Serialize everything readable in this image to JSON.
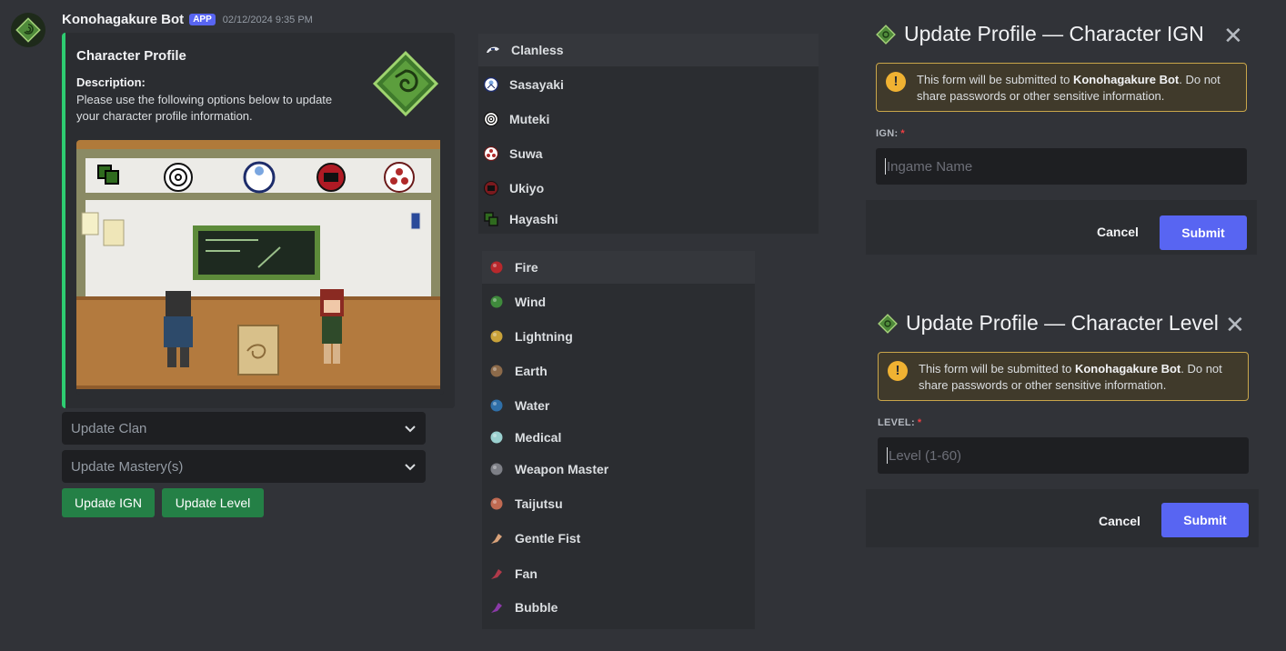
{
  "message": {
    "username": "Konohagakure Bot",
    "badge": "APP",
    "timestamp": "02/12/2024 9:35 PM",
    "embed": {
      "title": "Character Profile",
      "description_label": "Description:",
      "description": "Please use the following options below to update your character profile information.",
      "accent_color": "#2ecc71"
    },
    "components": {
      "clan_select_placeholder": "Update Clan",
      "mastery_select_placeholder": "Update Mastery(s)",
      "update_ign_label": "Update IGN",
      "update_level_label": "Update Level"
    }
  },
  "clan_options": [
    {
      "label": "Clanless",
      "icon": "clanless-icon",
      "highlighted": true
    },
    {
      "label": "Sasayaki",
      "icon": "sasayaki-clan-icon"
    },
    {
      "label": "Muteki",
      "icon": "muteki-clan-icon"
    },
    {
      "label": "Suwa",
      "icon": "suwa-clan-icon"
    },
    {
      "label": "Ukiyo",
      "icon": "ukiyo-clan-icon"
    },
    {
      "label": "Hayashi",
      "icon": "hayashi-clan-icon"
    }
  ],
  "mastery_options": [
    {
      "label": "Fire",
      "icon": "fire-orb-icon",
      "color": "#b8282c",
      "highlighted": true
    },
    {
      "label": "Wind",
      "icon": "wind-orb-icon",
      "color": "#3f8a3c"
    },
    {
      "label": "Lightning",
      "icon": "lightning-orb-icon",
      "color": "#c9a23a"
    },
    {
      "label": "Earth",
      "icon": "earth-orb-icon",
      "color": "#8c6a4a"
    },
    {
      "label": "Water",
      "icon": "water-orb-icon",
      "color": "#2f6fa8"
    },
    {
      "label": "Medical",
      "icon": "medical-orb-icon",
      "color": "#9ad0cf"
    },
    {
      "label": "Weapon Master",
      "icon": "weapon-orb-icon",
      "color": "#7d7f86"
    },
    {
      "label": "Taijutsu",
      "icon": "taijutsu-orb-icon",
      "color": "#c06a52"
    },
    {
      "label": "Gentle Fist",
      "icon": "gentle-fist-icon",
      "color": "#d9a27a"
    },
    {
      "label": "Fan",
      "icon": "fan-icon",
      "color": "#b13a4a"
    },
    {
      "label": "Bubble",
      "icon": "bubble-wand-icon",
      "color": "#8b3aa8"
    }
  ],
  "modal_ign": {
    "title": "Update Profile — Character IGN",
    "warning_prefix": "This form will be submitted to ",
    "warning_bold": "Konohagakure Bot",
    "warning_suffix": ". Do not share passwords or other sensitive information.",
    "field_label": "IGN:",
    "required_mark": "*",
    "placeholder": "Ingame Name",
    "cancel": "Cancel",
    "submit": "Submit"
  },
  "modal_level": {
    "title": "Update Profile — Character Level",
    "warning_prefix": "This form will be submitted to ",
    "warning_bold": "Konohagakure Bot",
    "warning_suffix": ". Do not share passwords or other sensitive information.",
    "field_label": "LEVEL:",
    "required_mark": "*",
    "placeholder": "Level (1-60)",
    "cancel": "Cancel",
    "submit": "Submit"
  },
  "colors": {
    "background": "#313338",
    "embed_bg": "#2b2d31",
    "input_bg": "#1e1f22",
    "blurple": "#5865f2",
    "green_button": "#248046",
    "warning_border": "#c9a64a"
  }
}
